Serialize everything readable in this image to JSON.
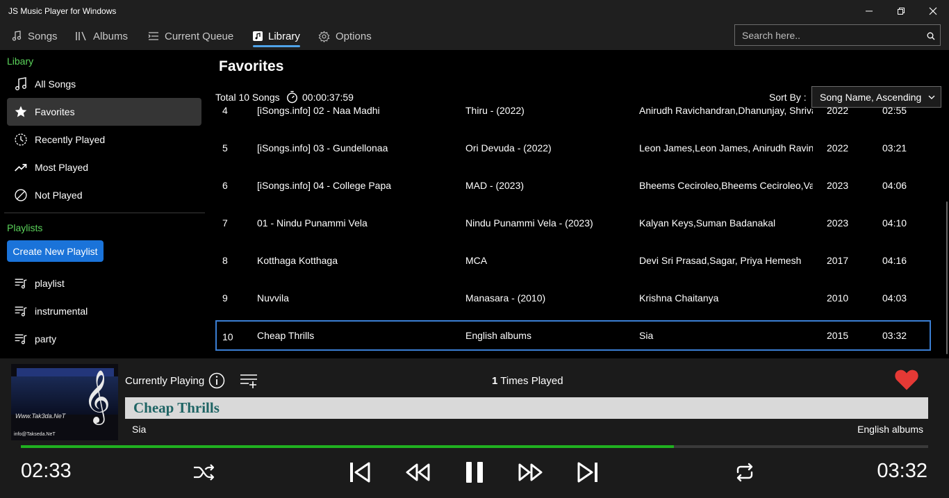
{
  "window": {
    "title": "JS Music Player for Windows"
  },
  "nav": {
    "tabs": [
      {
        "label": "Songs",
        "icon": "music-note-icon"
      },
      {
        "label": "Albums",
        "icon": "albums-icon"
      },
      {
        "label": "Current Queue",
        "icon": "queue-list-icon"
      },
      {
        "label": "Library",
        "icon": "library-icon",
        "active": true
      },
      {
        "label": "Options",
        "icon": "gear-icon"
      }
    ],
    "search_placeholder": "Search here.."
  },
  "sidebar": {
    "library_label": "Libary",
    "items": [
      {
        "label": "All Songs",
        "icon": "music-note-icon"
      },
      {
        "label": "Favorites",
        "icon": "star-icon",
        "active": true
      },
      {
        "label": "Recently Played",
        "icon": "history-icon"
      },
      {
        "label": "Most Played",
        "icon": "trending-icon"
      },
      {
        "label": "Not Played",
        "icon": "blocked-icon"
      }
    ],
    "playlists_label": "Playlists",
    "create_button": "Create New Playlist",
    "playlists": [
      {
        "label": "playlist"
      },
      {
        "label": "instrumental"
      },
      {
        "label": "party"
      }
    ]
  },
  "main": {
    "title": "Favorites",
    "total_songs": "Total 10 Songs",
    "total_duration": "00:00:37:59",
    "sort_label": "Sort By :",
    "sort_value": "Song Name, Ascending",
    "rows": [
      {
        "num": "4",
        "title": "[iSongs.info] 02 - Naa Madhi",
        "album": "Thiru - (2022)",
        "artist": "Anirudh Ravichandran,Dhanunjay, Shriva",
        "year": "2022",
        "duration": "02:55"
      },
      {
        "num": "5",
        "title": "[iSongs.info] 03 - Gundellonaa",
        "album": "Ori Devuda - (2022)",
        "artist": "Leon James,Leon James, Anirudh Ravinch",
        "year": "2022",
        "duration": "03:21"
      },
      {
        "num": "6",
        "title": "[iSongs.info] 04 - College Papa",
        "album": "MAD - (2023)",
        "artist": "Bheems Ceciroleo,Bheems Ceciroleo,Vara",
        "year": "2023",
        "duration": "04:06"
      },
      {
        "num": "7",
        "title": "01 - Nindu Punammi Vela",
        "album": "Nindu Punammi Vela - (2023)",
        "artist": "Kalyan Keys,Suman Badanakal",
        "year": "2023",
        "duration": "04:10"
      },
      {
        "num": "8",
        "title": "Kotthaga Kotthaga",
        "album": "MCA",
        "artist": "Devi Sri Prasad,Sagar, Priya Hemesh",
        "year": "2017",
        "duration": "04:16"
      },
      {
        "num": "9",
        "title": "Nuvvila",
        "album": "Manasara - (2010)",
        "artist": "Krishna Chaitanya",
        "year": "2010",
        "duration": "04:03"
      },
      {
        "num": "10",
        "title": "Cheap Thrills",
        "album": "English albums",
        "artist": "Sia",
        "year": "2015",
        "duration": "03:32",
        "selected": true
      }
    ]
  },
  "player": {
    "currently_playing_label": "Currently Playing",
    "times_played_count": "1",
    "times_played_label": "Times Played",
    "song_title": "Cheap Thrills",
    "artist": "Sia",
    "album": "English albums",
    "current_time": "02:33",
    "total_time": "03:32",
    "progress": 0.72,
    "album_art_text": {
      "brand": "Www.Tak3da.NeT",
      "email": "info@Takseda.NeT"
    },
    "colors": {
      "progress": "#20b020",
      "heart": "#e53935",
      "accent": "#1a73d9",
      "section": "#5bd45b"
    }
  }
}
